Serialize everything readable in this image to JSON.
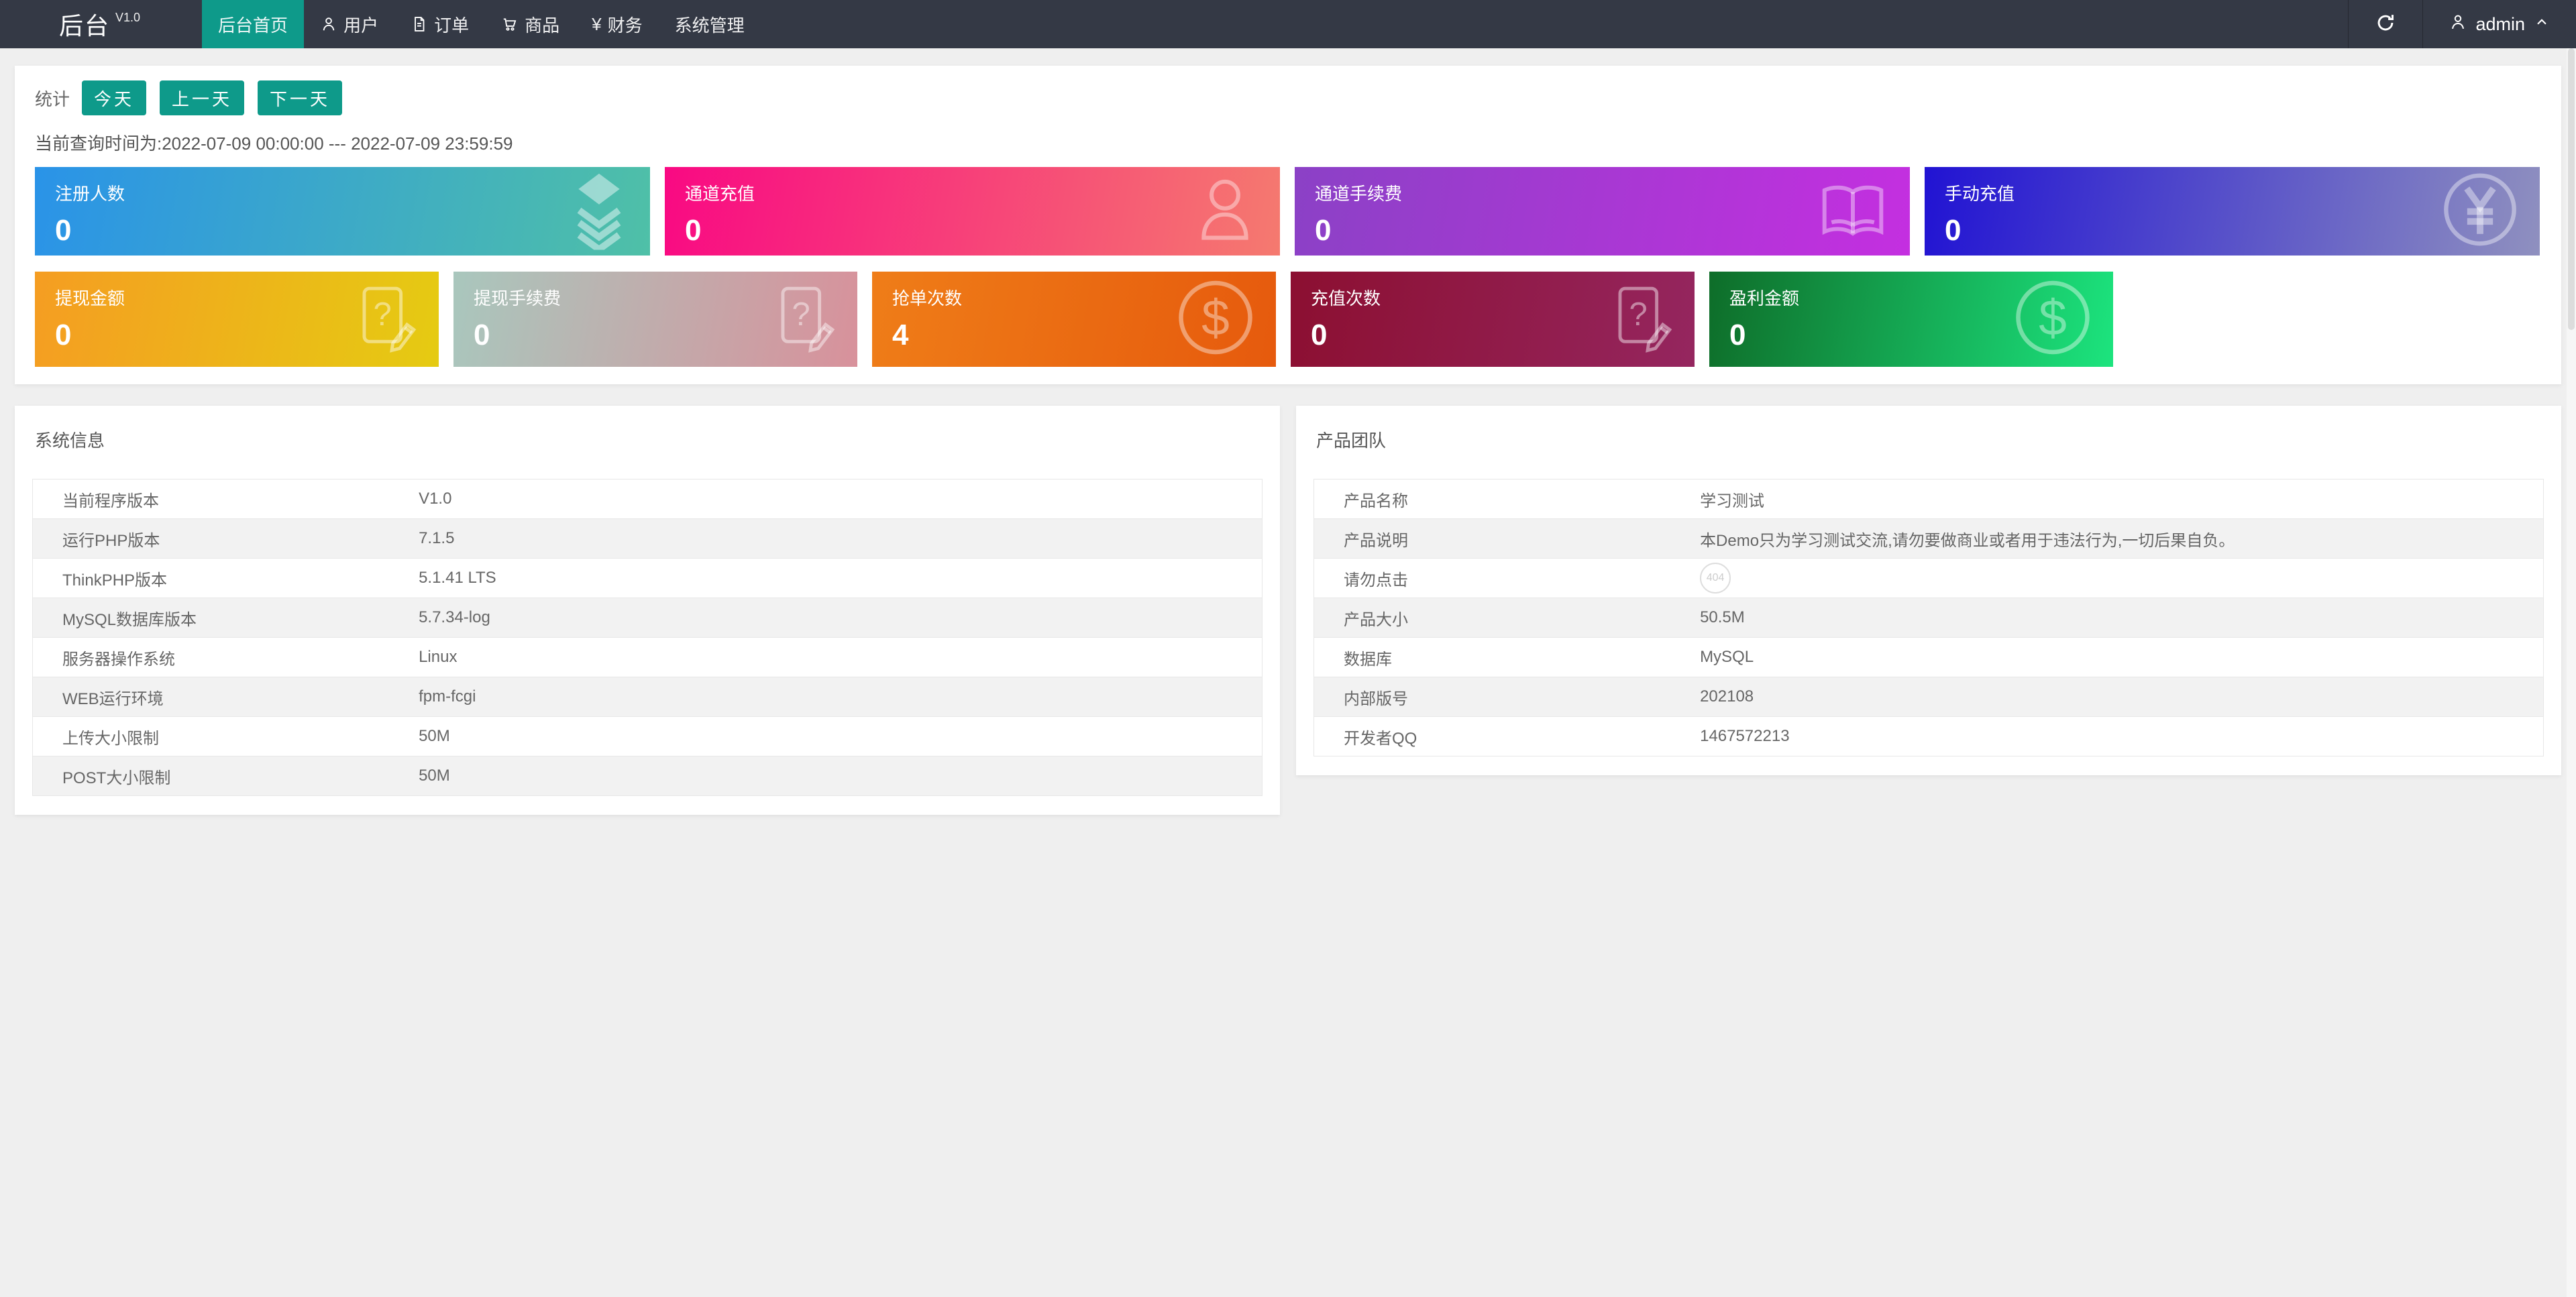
{
  "theme": {
    "accent": "#0e9a8a",
    "navbar_bg": "#343945",
    "page_bg": "#efefef"
  },
  "navbar": {
    "title": "后台",
    "version": "V1.0",
    "items": [
      {
        "label": "后台首页",
        "active": true
      },
      {
        "label": "用户",
        "icon": "user-icon"
      },
      {
        "label": "订单",
        "icon": "order-icon"
      },
      {
        "label": "商品",
        "icon": "cart-icon"
      },
      {
        "label": "财务",
        "icon": "yen-icon"
      },
      {
        "label": "系统管理"
      }
    ],
    "username": "admin"
  },
  "stats": {
    "label": "统计",
    "buttons": [
      {
        "label": "今天"
      },
      {
        "label": "上一天"
      },
      {
        "label": "下一天"
      }
    ],
    "query_time": "当前查询时间为:2022-07-09 00:00:00 --- 2022-07-09 23:59:59"
  },
  "cards": {
    "row1": [
      {
        "title": "注册人数",
        "value": 0,
        "icon": "layers-icon",
        "gradient": {
          "from": "#2a93e8",
          "to": "#4fc0a7"
        }
      },
      {
        "title": "通道充值",
        "value": 0,
        "icon": "person-icon",
        "gradient": {
          "from": "#f90983",
          "to": "#f57a6f"
        }
      },
      {
        "title": "通道手续费",
        "value": 0,
        "icon": "open-book-icon",
        "gradient": {
          "from": "#8b41c6",
          "to": "#c42fe0"
        }
      },
      {
        "title": "手动充值",
        "value": 0,
        "icon": "yen-circle-icon",
        "gradient": {
          "from": "#2113d3",
          "to": "#8f90bf"
        }
      }
    ],
    "row2": [
      {
        "title": "提现金额",
        "value": 0,
        "icon": "edit-help-icon",
        "gradient": {
          "from": "#f59d22",
          "to": "#e5cb12"
        }
      },
      {
        "title": "提现手续费",
        "value": 0,
        "icon": "edit-help-icon",
        "gradient": {
          "from": "#a9c7bd",
          "to": "#d8919b"
        }
      },
      {
        "title": "抢单次数",
        "value": 4,
        "icon": "dollar-circle-icon",
        "gradient": {
          "from": "#ef7d18",
          "to": "#e65a0d"
        }
      },
      {
        "title": "充值次数",
        "value": 0,
        "icon": "edit-help-icon",
        "gradient": {
          "from": "#8c0f31",
          "to": "#95265f"
        }
      },
      {
        "title": "盈利金额",
        "value": 0,
        "icon": "dollar-circle-icon",
        "gradient": {
          "from": "#0e6d29",
          "to": "#1ce47e"
        }
      }
    ]
  },
  "system_info": {
    "title": "系统信息",
    "rows": [
      {
        "label": "当前程序版本",
        "value": "V1.0"
      },
      {
        "label": "运行PHP版本",
        "value": "7.1.5"
      },
      {
        "label": "ThinkPHP版本",
        "value": "5.1.41 LTS"
      },
      {
        "label": "MySQL数据库版本",
        "value": "5.7.34-log"
      },
      {
        "label": "服务器操作系统",
        "value": "Linux"
      },
      {
        "label": "WEB运行环境",
        "value": "fpm-fcgi"
      },
      {
        "label": "上传大小限制",
        "value": "50M"
      },
      {
        "label": "POST大小限制",
        "value": "50M"
      }
    ]
  },
  "product_team": {
    "title": "产品团队",
    "rows": [
      {
        "label": "产品名称",
        "value": "学习测试"
      },
      {
        "label": "产品说明",
        "value": "本Demo只为学习测试交流,请勿要做商业或者用于违法行为,一切后果自负。"
      },
      {
        "label": "请勿点击",
        "value": "",
        "badge": "404"
      },
      {
        "label": "产品大小",
        "value": "50.5M"
      },
      {
        "label": "数据库",
        "value": "MySQL"
      },
      {
        "label": "内部版号",
        "value": "202108"
      },
      {
        "label": "开发者QQ",
        "value": "1467572213"
      }
    ]
  }
}
